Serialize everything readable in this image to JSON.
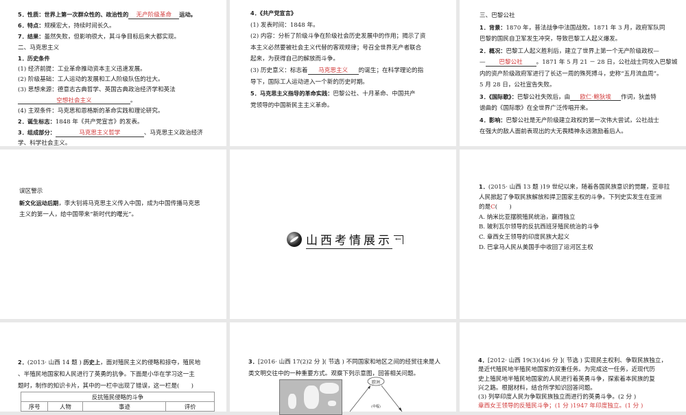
{
  "slides": [
    {
      "lines": [
        [
          {
            "k": "b",
            "v": "5．性质：世界上第一次群众性的、政治性的"
          },
          {
            "k": "a",
            "v": "无产阶级革命",
            "w": "w1"
          },
          {
            "k": "b",
            "v": "运动。"
          }
        ],
        [
          {
            "k": "b",
            "v": "6．特点："
          },
          {
            "k": "t",
            "v": "规模宏大，持续时间长久。"
          }
        ],
        [
          {
            "k": "b",
            "v": "7．结果："
          },
          {
            "k": "t",
            "v": "虽然失败，但影响很大，其斗争目标后来大都实现。"
          }
        ],
        [
          {
            "k": "h",
            "v": "二、马克思主义"
          }
        ],
        [
          {
            "k": "b",
            "v": "1．历史条件"
          }
        ],
        [
          {
            "k": "t",
            "v": "(1) 经济前提：工业革命推动资本主义迅速发展。"
          }
        ],
        [
          {
            "k": "t",
            "v": "(2) 阶级基础：工人运动的发展和工人阶级队伍的壮大。"
          }
        ],
        [
          {
            "k": "t",
            "v": "(3) 思想来源：德意志古典哲学、英国古典政治经济学和英法"
          }
        ],
        [
          {
            "k": "a",
            "v": "空想社会主义",
            "w": "w2"
          },
          {
            "k": "t",
            "v": "。"
          }
        ],
        [
          {
            "k": "t",
            "v": "(4) 主观条件：马克思和恩格斯的革命实践和理论研究。"
          }
        ],
        [
          {
            "k": "b",
            "v": "2．诞生标志："
          },
          {
            "k": "t",
            "v": "1848 年《共产党宣言》的发表。"
          }
        ],
        [
          {
            "k": "b",
            "v": "3．组成部分："
          },
          {
            "k": "a",
            "v": "马克思主义哲学",
            "w": "w3"
          },
          {
            "k": "t",
            "v": "、马克思主义政治经济"
          }
        ],
        [
          {
            "k": "t",
            "v": "学、科学社会主义。"
          }
        ]
      ]
    },
    {
      "lines": [
        [
          {
            "k": "b",
            "v": "4．《共产党宣言》"
          }
        ],
        [
          {
            "k": "t",
            "v": "(1) 发表时间：1848 年。"
          }
        ],
        [
          {
            "k": "t",
            "v": "(2) 内容：分析了阶级斗争在阶级社会历史发展中的作用；揭示了资"
          }
        ],
        [
          {
            "k": "t",
            "v": "本主义必然要被社会主义代替的客观规律；号召全世界无产者联合"
          }
        ],
        [
          {
            "k": "t",
            "v": "起来，为获得自己的解放而斗争。"
          }
        ],
        [
          {
            "k": "t",
            "v": "(3) 历史意义：标志着"
          },
          {
            "k": "a",
            "v": "马克思主义",
            "w": "w1"
          },
          {
            "k": "t",
            "v": "的诞生；在科学理论的指"
          }
        ],
        [
          {
            "k": "t",
            "v": "导下，国际工人运动进入一个新的历史时期。"
          }
        ],
        [
          {
            "k": "b",
            "v": "5．马克思主义指导的革命实践："
          },
          {
            "k": "t",
            "v": "巴黎公社、十月革命、中国共产"
          }
        ],
        [
          {
            "k": "t",
            "v": "党领导的中国新民主主义革命。"
          }
        ]
      ]
    },
    {
      "lines": [
        [
          {
            "k": "h",
            "v": "三、巴黎公社"
          }
        ],
        [
          {
            "k": "b",
            "v": "1．背景："
          },
          {
            "k": "t",
            "v": "1870 年，普法战争中法国战败。1871 年 3 月，政府军队同"
          }
        ],
        [
          {
            "k": "t",
            "v": "巴黎的国民自卫军发生冲突，导致巴黎工人起义爆发。"
          }
        ],
        [
          {
            "k": "b",
            "v": "2．概况："
          },
          {
            "k": "t",
            "v": "巴黎工人起义胜利后，建立了世界上第一个无产阶级政权—"
          }
        ],
        [
          {
            "k": "t",
            "v": "—"
          },
          {
            "k": "a",
            "v": "巴黎公社",
            "w": "w1"
          },
          {
            "k": "t",
            "v": "。1871 年 5 月 21 － 28 日，公社战士同攻入巴黎城"
          }
        ],
        [
          {
            "k": "t",
            "v": "内的资产阶级政府军进行了长达一周的殊死搏斗，史称“五月流血周”。"
          }
        ],
        [
          {
            "k": "t",
            "v": "5 月 28 日，公社宣告失败。"
          }
        ],
        [
          {
            "k": "b",
            "v": "3．《国际歌》："
          },
          {
            "k": "t",
            "v": "巴黎公社失败后，由"
          },
          {
            "k": "a",
            "v": "欧仁·鲍狄埃",
            "w": "w1"
          },
          {
            "k": "t",
            "v": "作词，狄盖特"
          }
        ],
        [
          {
            "k": "t",
            "v": "谱曲的《国际歌》在全世界广泛传唱开来。"
          }
        ],
        [
          {
            "k": "b",
            "v": "4．影响："
          },
          {
            "k": "t",
            "v": "巴黎公社是无产阶级建立政权的第一次伟大尝试，公社战士"
          }
        ],
        [
          {
            "k": "t",
            "v": "在强大的敌人面前表现出的大无畏精神永远激励着后人。"
          }
        ]
      ]
    },
    {
      "lines": [
        [
          {
            "k": "h",
            "v": "误区警示"
          }
        ],
        [
          {
            "k": "b",
            "v": "新文化运动后期"
          },
          {
            "k": "t",
            "v": "，李大钊将马克思主义传入中国，成为中国传播马克思"
          }
        ],
        [
          {
            "k": "t",
            "v": "主义的第一人，给中国带来“新时代的曙光”。"
          }
        ]
      ]
    },
    {
      "title": "山西考情展示"
    },
    {
      "lines": [
        [
          {
            "k": "b",
            "v": "1．"
          },
          {
            "k": "t",
            "v": "(2015· 山西 13 题 )19 世纪以来，随着各国民族意识的觉醒，亚非拉"
          }
        ],
        [
          {
            "k": "t",
            "v": "人民掀起了争取民族解放和捍卫国家主权的斗争。下列史实发生在亚洲"
          }
        ],
        [
          {
            "k": "t",
            "v": "的是"
          },
          {
            "k": "r",
            "v": "C"
          },
          {
            "k": "t",
            "v": "(　　)"
          }
        ],
        [
          {
            "k": "t",
            "v": "A. 纳米比亚摆脱殖民统治，赢得独立"
          }
        ],
        [
          {
            "k": "t",
            "v": "B. 玻利瓦尔领导的反抗西班牙殖民统治的斗争"
          }
        ],
        [
          {
            "k": "t",
            "v": "C. 章西女王领导的印度民族大起义"
          }
        ],
        [
          {
            "k": "t",
            "v": "D. 巴拿马人民从美国手中收回了运河区主权"
          }
        ]
      ]
    },
    {
      "lines": [
        [
          {
            "k": "b",
            "v": "2．"
          },
          {
            "k": "t",
            "v": "(2013· 山西 14 题 ) "
          },
          {
            "k": "b",
            "v": "历史上"
          },
          {
            "k": "t",
            "v": "，面对殖民主义的侵略和掠夺，殖民地"
          }
        ],
        [
          {
            "k": "t",
            "v": "、半殖民地国家和人民进行了英勇的抗争。下面是小华在学习这一主"
          }
        ],
        [
          {
            "k": "t",
            "v": "题时，制作的知识卡片，其中的一栏中出现了错误，这一栏是"
          },
          {
            "k": "t",
            "v": "(　　)"
          }
        ]
      ],
      "table": {
        "caption": "反抗殖民侵略的斗争",
        "headers": [
          "序号",
          "人物",
          "事迹",
          "评价"
        ]
      }
    },
    {
      "lines": [
        [
          {
            "k": "b",
            "v": "3．"
          },
          {
            "k": "t",
            "v": "[2016· 山西 17(2)2 分 ]( 节选 ) 不同国家和地区之间的经贸往来是人"
          }
        ],
        [
          {
            "k": "t",
            "v": "类文明交往中的一种重要方式。观察下列示意图，回答相关问题。"
          }
        ]
      ],
      "diagram": {
        "top_node": "欧洲",
        "center_label": "(中程)"
      }
    },
    {
      "lines": [
        [
          {
            "k": "b",
            "v": "4．"
          },
          {
            "k": "t",
            "v": "[2012· 山西 19(3)(4)6 分 ]( 节选 ) 实现民主权利、争取民族独立，"
          }
        ],
        [
          {
            "k": "t",
            "v": "是近代殖民地半殖民地国家的双重任务。为完成这一任务，近现代历"
          }
        ],
        [
          {
            "k": "t",
            "v": "史上殖民地半殖民地国家的人民进行着英勇斗争，探索着本民族的复"
          }
        ],
        [
          {
            "k": "t",
            "v": "兴之路。根据材料，结合所学知识回答问题。"
          }
        ],
        [
          {
            "k": "t",
            "v": "(3) 列举印度人民为争取民族独立而进行的英勇斗争。(2 分 )"
          }
        ],
        [
          {
            "k": "r",
            "v": "章西女王领导的反殖民斗争；(1 分 )1947 年印度独立。(1 分 )"
          }
        ]
      ]
    }
  ],
  "colors": {
    "answer": "#d23a3a",
    "gap": "#e8e8e8"
  }
}
